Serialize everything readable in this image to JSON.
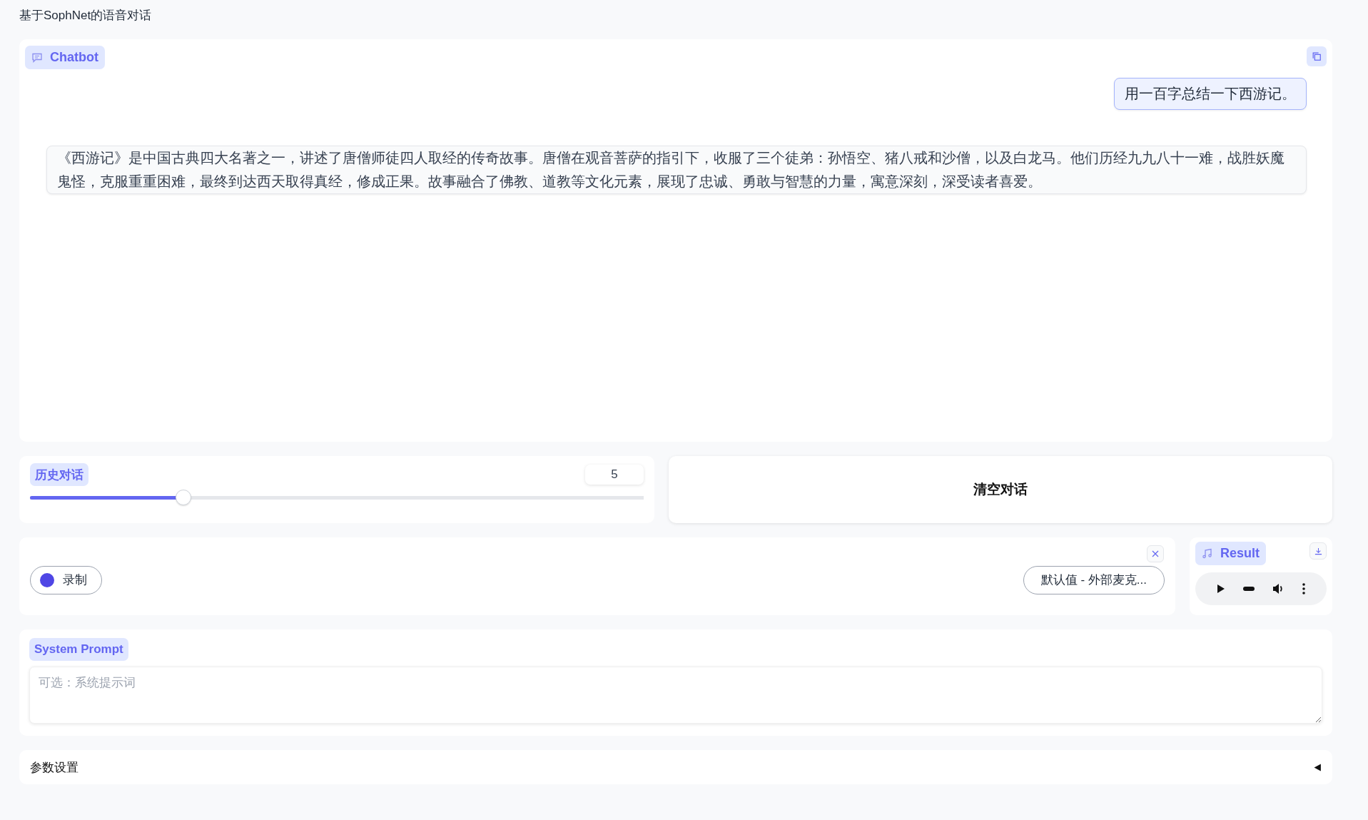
{
  "page_title": "基于SophNet的语音对话",
  "chatbot": {
    "label": "Chatbot",
    "user_message": "用一百字总结一下西游记。",
    "bot_message": "《西游记》是中国古典四大名著之一，讲述了唐僧师徒四人取经的传奇故事。唐僧在观音菩萨的指引下，收服了三个徒弟：孙悟空、猪八戒和沙僧，以及白龙马。他们历经九九八十一难，战胜妖魔鬼怪，克服重重困难，最终到达西天取得真经，修成正果。故事融合了佛教、道教等文化元素，展现了忠诚、勇敢与智慧的力量，寓意深刻，深受读者喜爱。"
  },
  "history_slider": {
    "label": "历史对话",
    "value": "5",
    "level": 0.25
  },
  "clear_button": "清空对话",
  "recorder": {
    "record_label": "录制",
    "device": "默认值 - 外部麦克..."
  },
  "result": {
    "label": "Result"
  },
  "system_prompt": {
    "label": "System Prompt",
    "placeholder": "可选：系统提示词"
  },
  "settings": {
    "label": "参数设置",
    "expanded": false
  }
}
